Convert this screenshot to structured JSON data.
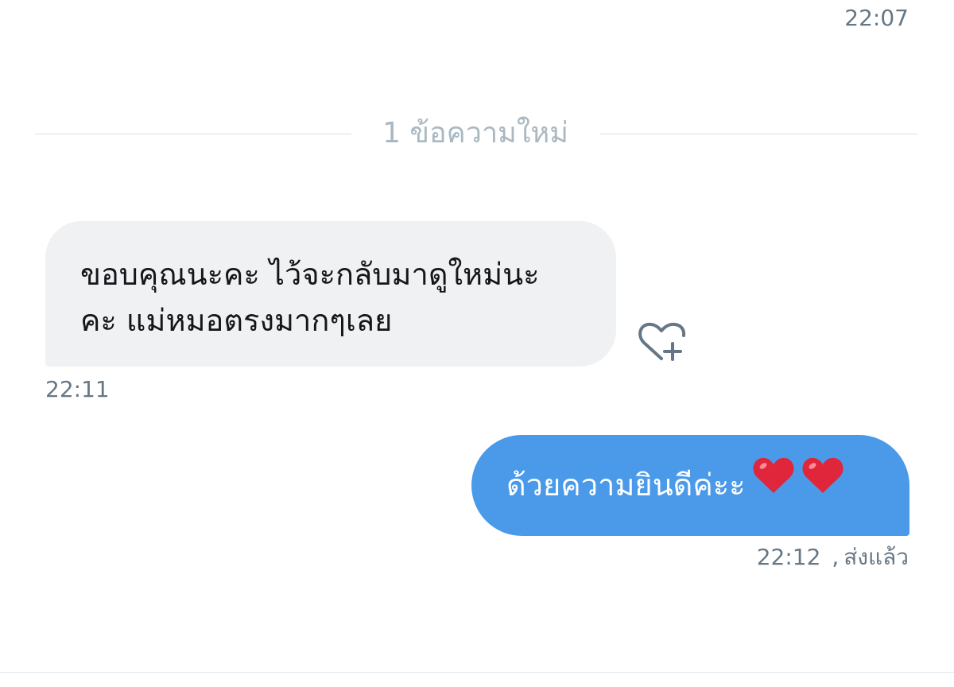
{
  "conversation": {
    "top_timestamp": "22:07",
    "new_messages_divider": "1 ข้อความใหม่",
    "messages": [
      {
        "direction": "incoming",
        "line1": "ขอบคุณนะคะ ไว้จะกลับมาดูใหม่นะ",
        "line2": "คะ แม่หมอตรงมากๆเลย",
        "timestamp": "22:11",
        "reaction_icon": "heart-plus-icon"
      },
      {
        "direction": "outgoing",
        "text": "ด้วยความยินดีค่ะะ",
        "emoji": [
          "red-heart-emoji",
          "red-heart-emoji"
        ],
        "timestamp": "22:12",
        "separator": ",",
        "status": "ส่งแล้ว"
      }
    ]
  },
  "colors": {
    "incoming_bubble": "#eff1f3",
    "outgoing_bubble": "#4a9ae9",
    "timestamp": "#657786",
    "divider_text": "#aab8c2",
    "heart": "#e0263b"
  }
}
